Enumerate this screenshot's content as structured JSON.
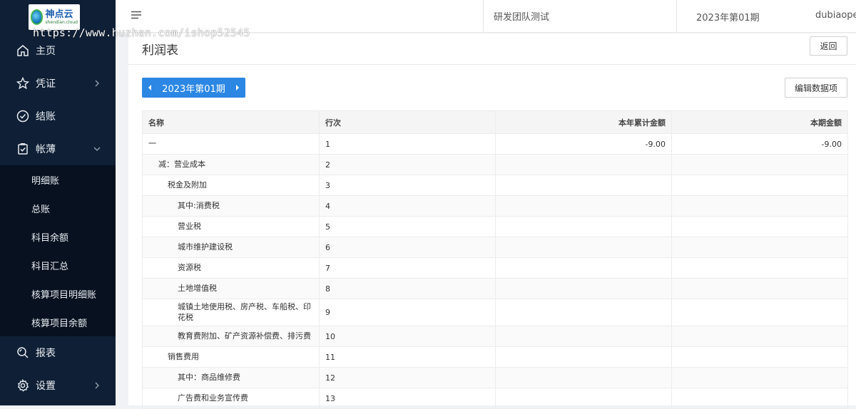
{
  "app": {
    "logo_text": "神点云",
    "logo_subtext": "shendian.cloud",
    "watermark": "https://www.huzhan.com/ishop52545"
  },
  "sidebar": {
    "items": [
      {
        "label": "主页",
        "icon": "home-icon"
      },
      {
        "label": "凭证",
        "icon": "star-icon",
        "arrow": "chevron-right-icon"
      },
      {
        "label": "结账",
        "icon": "check-circle-icon"
      },
      {
        "label": "帐薄",
        "icon": "clipboard-icon",
        "arrow": "chevron-down-icon"
      }
    ],
    "submenu": [
      {
        "label": "明细账"
      },
      {
        "label": "总账"
      },
      {
        "label": "科目余额"
      },
      {
        "label": "科目汇总"
      },
      {
        "label": "核算项目明细账"
      },
      {
        "label": "核算项目余额"
      }
    ],
    "bottom_items": [
      {
        "label": "报表",
        "icon": "search-icon"
      },
      {
        "label": "设置",
        "icon": "gear-icon",
        "arrow": "chevron-right-icon"
      }
    ]
  },
  "header": {
    "team": "研发团队测试",
    "period": "2023年第01期",
    "user": "dubiaopei"
  },
  "main": {
    "title": "利润表",
    "back_label": "返回",
    "period_picker_label": "2023年第01期",
    "edit_label": "编辑数据项"
  },
  "table": {
    "headers": {
      "name": "名称",
      "line": "行次",
      "ytd": "本年累计金额",
      "period": "本期金额"
    },
    "rows": [
      {
        "name": "一",
        "indent": 0,
        "line": "1",
        "ytd": "-9.00",
        "period": "-9.00"
      },
      {
        "name": "减：营业成本",
        "indent": 1,
        "line": "2",
        "ytd": "",
        "period": ""
      },
      {
        "name": "税金及附加",
        "indent": 2,
        "line": "3",
        "ytd": "",
        "period": ""
      },
      {
        "name": "其中:消费税",
        "indent": 3,
        "line": "4",
        "ytd": "",
        "period": ""
      },
      {
        "name": "营业税",
        "indent": 3,
        "line": "5",
        "ytd": "",
        "period": ""
      },
      {
        "name": "城市维护建设税",
        "indent": 3,
        "line": "6",
        "ytd": "",
        "period": ""
      },
      {
        "name": "资源税",
        "indent": 3,
        "line": "7",
        "ytd": "",
        "period": ""
      },
      {
        "name": "土地增值税",
        "indent": 3,
        "line": "8",
        "ytd": "",
        "period": ""
      },
      {
        "name": "城镇土地使用税、房产税、车船税、印花税",
        "indent": 3,
        "line": "9",
        "ytd": "",
        "period": "",
        "tall": true
      },
      {
        "name": "教育费附加、矿产资源补偿费、排污费",
        "indent": 3,
        "line": "10",
        "ytd": "",
        "period": ""
      },
      {
        "name": "销售费用",
        "indent": 2,
        "line": "11",
        "ytd": "",
        "period": ""
      },
      {
        "name": "其中：商品维修费",
        "indent": 3,
        "line": "12",
        "ytd": "",
        "period": ""
      },
      {
        "name": "广告费和业务宣传费",
        "indent": 3,
        "line": "13",
        "ytd": "",
        "period": ""
      }
    ]
  },
  "colors": {
    "sidebar_bg": "#0f1f35",
    "submenu_bg": "#07111f",
    "accent": "#2b87e3"
  }
}
